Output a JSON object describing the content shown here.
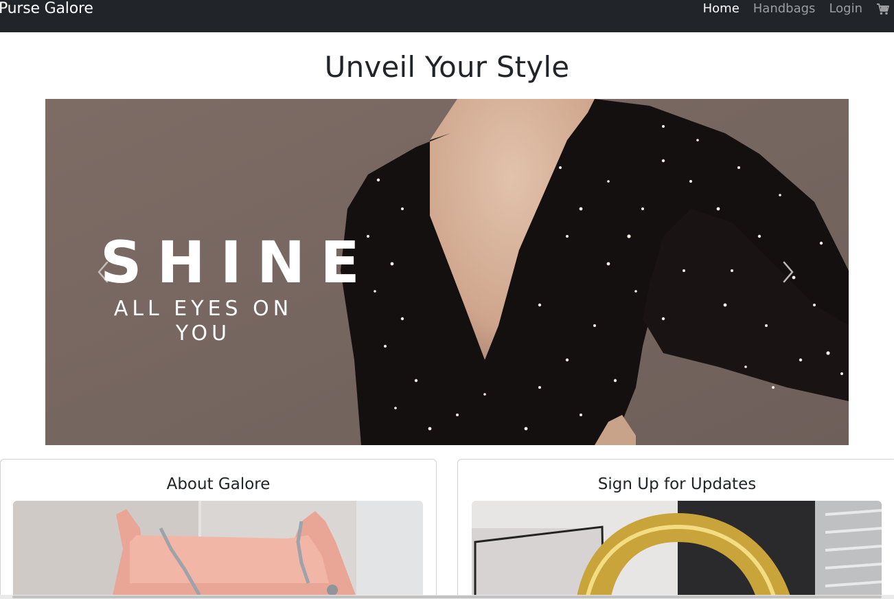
{
  "navbar": {
    "brand": "Purse Galore",
    "links": [
      {
        "label": "Home",
        "active": true
      },
      {
        "label": "Handbags",
        "active": false
      },
      {
        "label": "Login",
        "active": false
      }
    ],
    "cart_icon": "cart-icon"
  },
  "hero": {
    "title": "Unveil Your Style"
  },
  "carousel": {
    "headline": "SHINE",
    "tagline": "ALL EYES ON YOU",
    "prev_icon": "chevron-left-icon",
    "next_icon": "chevron-right-icon"
  },
  "cards": {
    "about": {
      "title": "About Galore"
    },
    "signup": {
      "title": "Sign Up for Updates"
    }
  },
  "colors": {
    "navbar_bg": "#212529",
    "carousel_bg": "#7b6a63"
  }
}
